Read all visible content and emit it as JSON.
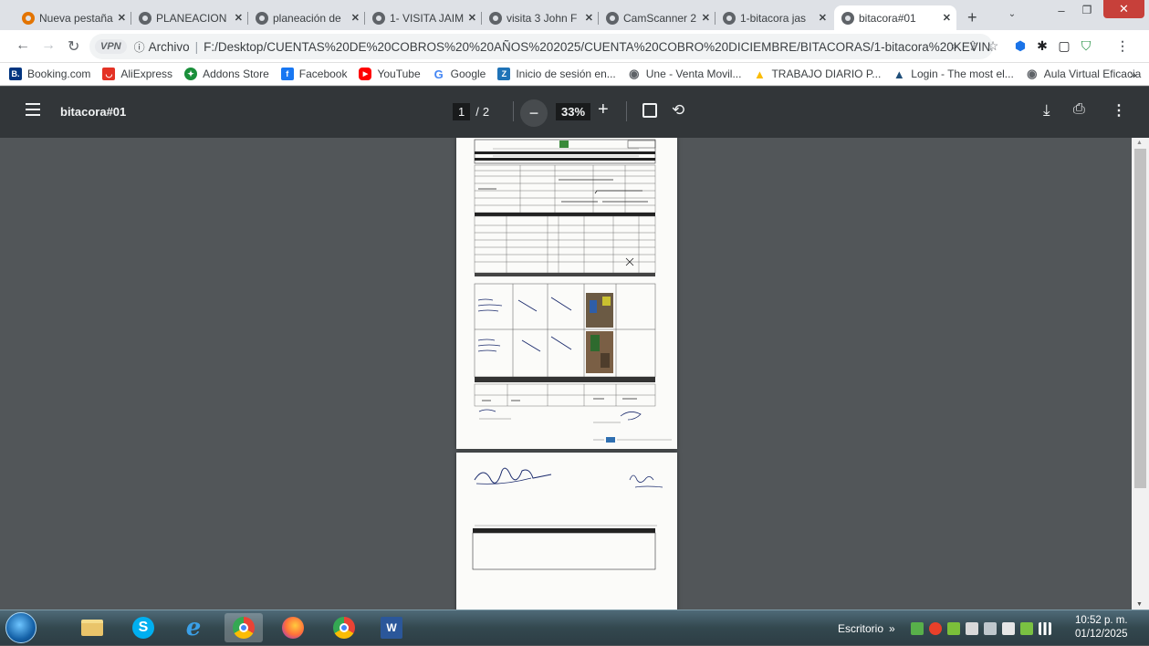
{
  "tabs": [
    {
      "title": "Nueva pestaña"
    },
    {
      "title": "PLANEACION"
    },
    {
      "title": "planeación de"
    },
    {
      "title": "1- VISITA JAIM"
    },
    {
      "title": "visita 3 John F"
    },
    {
      "title": "CamScanner 2"
    },
    {
      "title": "1-bitacora jas"
    },
    {
      "title": "bitacora#01"
    }
  ],
  "active_tab": "bitacora#01",
  "address": {
    "vpn": "VPN",
    "scheme": "Archivo",
    "url": "F:/Desktop/CUENTAS%20DE%20COBROS%20%20AÑOS%202025/CUENTA%20COBRO%20DICIEMBRE/BITACORAS/1-bitacora%20KEVIN..."
  },
  "bookmarks": [
    {
      "label": "Booking.com",
      "icon": "booking-icon",
      "color": "#003580",
      "glyph": "B."
    },
    {
      "label": "AliExpress",
      "icon": "aliexpress-icon",
      "color": "#e43225",
      "glyph": "◡"
    },
    {
      "label": "Addons Store",
      "icon": "addons-icon",
      "color": "#1a8f3a",
      "glyph": "✦"
    },
    {
      "label": "Facebook",
      "icon": "facebook-icon",
      "color": "#1877f2",
      "glyph": "f"
    },
    {
      "label": "YouTube",
      "icon": "youtube-icon",
      "color": "#ff0000",
      "glyph": "▶"
    },
    {
      "label": "Google",
      "icon": "google-icon",
      "color": "#4285f4",
      "glyph": "G"
    },
    {
      "label": "Inicio de sesión en...",
      "icon": "zoho-icon",
      "color": "#1f73b7",
      "glyph": "Z"
    },
    {
      "label": "Une - Venta Movil...",
      "icon": "globe-icon",
      "color": "#5f6368",
      "glyph": "◉"
    },
    {
      "label": "TRABAJO DIARIO P...",
      "icon": "drive-icon",
      "color": "#fbbc04",
      "glyph": "▲"
    },
    {
      "label": "Login - The most el...",
      "icon": "login-icon",
      "color": "#1f4e79",
      "glyph": "▲"
    },
    {
      "label": "Aula Virtual Eficacia",
      "icon": "globe-icon",
      "color": "#5f6368",
      "glyph": "◉"
    }
  ],
  "bookmarks_more": "»",
  "pdf": {
    "title": "bitacora#01",
    "page_current": "1",
    "page_sep": "/",
    "page_total": "2",
    "zoom": "33%"
  },
  "taskbar": {
    "tray_label": "Escritorio",
    "tray_more": "»",
    "time": "10:52 p. m.",
    "date": "01/12/2025"
  }
}
